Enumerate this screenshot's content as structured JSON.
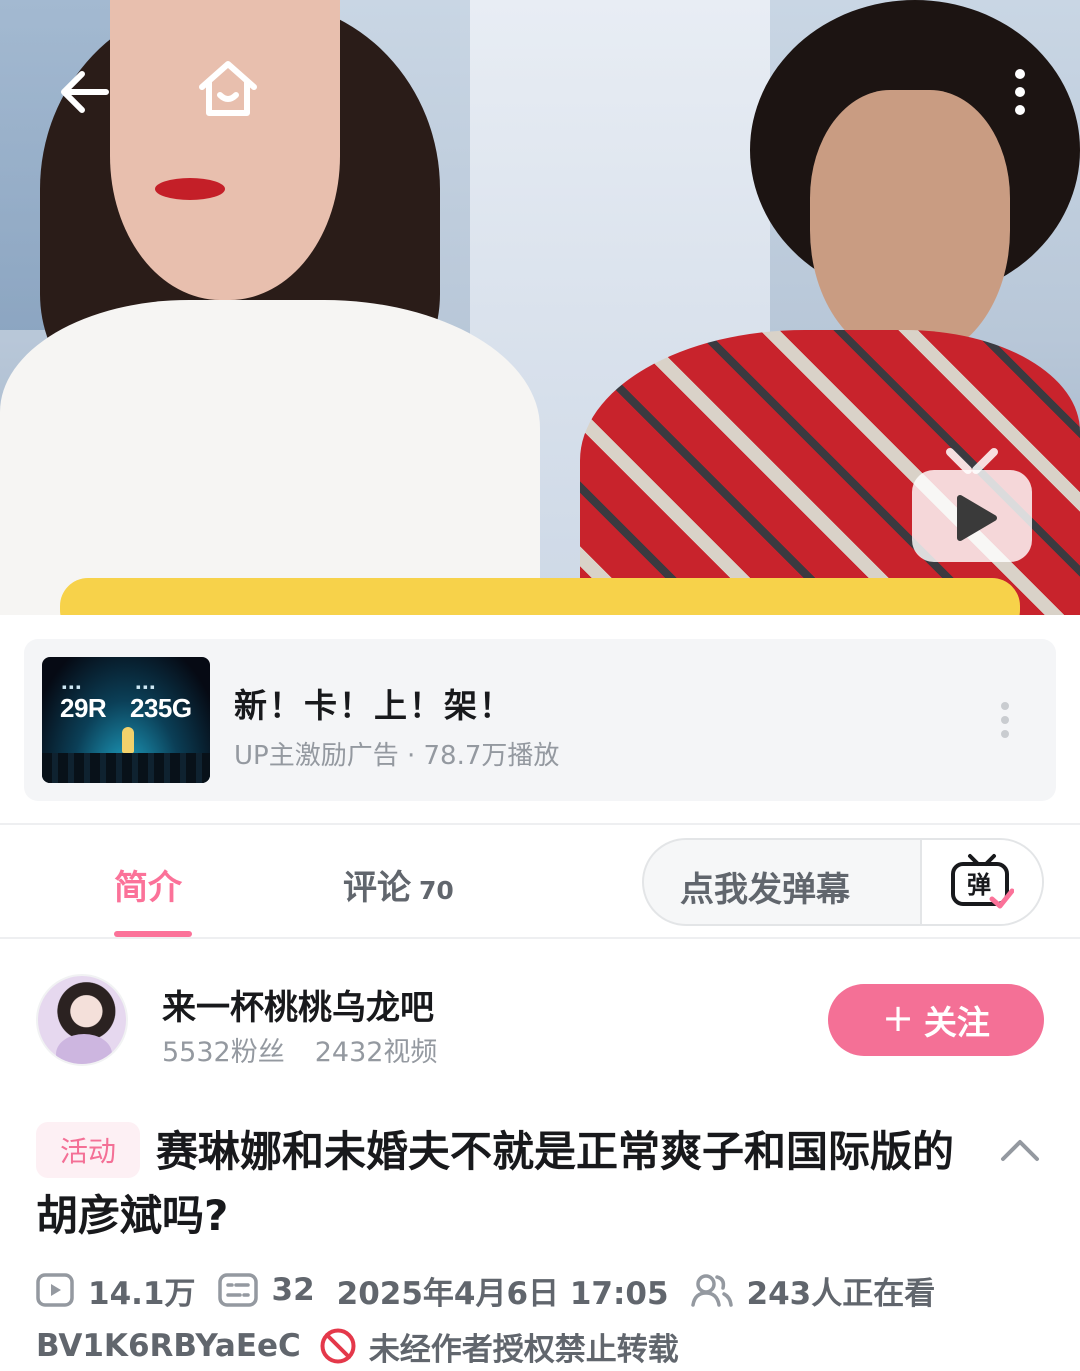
{
  "player": {
    "overlay_icons": [
      "back-arrow-icon",
      "home-icon",
      "more-vertical-icon",
      "play-badge-icon"
    ]
  },
  "ad": {
    "thumb_stat_left": "29R",
    "thumb_stat_right": "235G",
    "title": "新！卡！上！架！",
    "meta": "UP主激励广告 · 78.7万播放"
  },
  "tabs": {
    "intro_label": "简介",
    "comments_label": "评论",
    "comments_count": "70",
    "danmaku_placeholder": "点我发弹幕",
    "danmaku_toggle_glyph": "弹"
  },
  "uploader": {
    "name": "来一杯桃桃乌龙吧",
    "fans": "5532粉丝",
    "videos": "2432视频",
    "follow_plus": "+",
    "follow_label": "关注"
  },
  "video": {
    "tag": "活动",
    "title": "赛琳娜和未婚夫不就是正常爽子和国际版的胡彦斌吗?",
    "views": "14.1万",
    "danmaku_count": "32",
    "date": "2025年4月6日 17:05",
    "watching": "243人正在看",
    "bvid": "BV1K6RBYaEeC",
    "repost_notice": "未经作者授权禁止转载"
  },
  "colors": {
    "accent": "#fb7299",
    "follow_button": "#f47096",
    "text_primary": "#18191c",
    "text_secondary": "#61666d",
    "text_muted": "#9499a0",
    "warning_red": "#e4384a"
  }
}
